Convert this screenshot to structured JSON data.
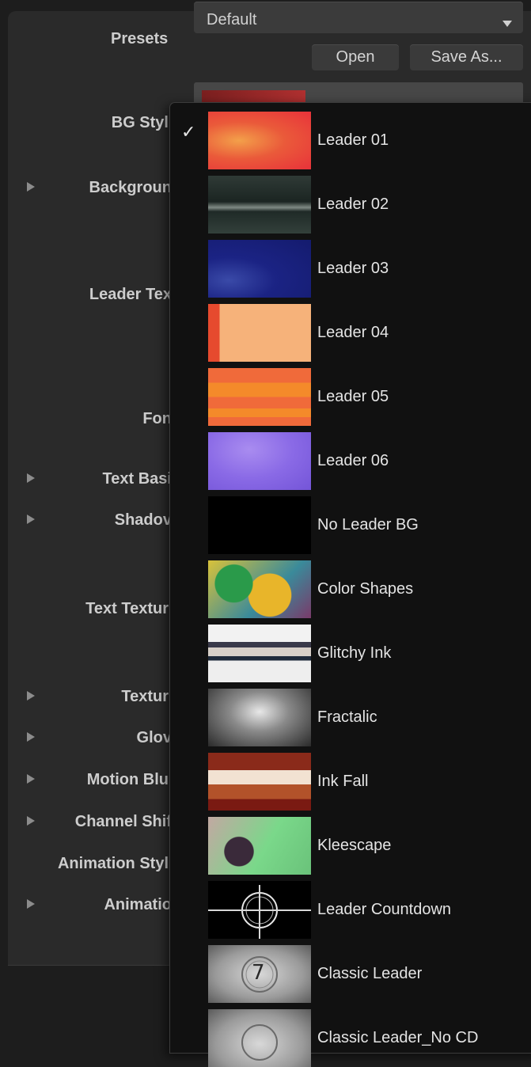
{
  "presets": {
    "label": "Presets",
    "selected": "Default",
    "open_label": "Open",
    "save_as_label": "Save As..."
  },
  "rows": [
    {
      "label": "BG Styl",
      "disclosure": false
    },
    {
      "label": "Backgroun",
      "disclosure": true
    },
    {
      "label": "Leader Tex",
      "disclosure": false
    },
    {
      "label": "Fon",
      "disclosure": false
    },
    {
      "label": "Text Basi",
      "disclosure": true
    },
    {
      "label": "Shadov",
      "disclosure": true
    },
    {
      "label": "Text Textur",
      "disclosure": false
    },
    {
      "label": "Textur",
      "disclosure": true
    },
    {
      "label": "Glov",
      "disclosure": true
    },
    {
      "label": "Motion Blu",
      "disclosure": true
    },
    {
      "label": "Channel Shif",
      "disclosure": true
    },
    {
      "label": "Animation Styl",
      "disclosure": false
    },
    {
      "label": "Animatio",
      "disclosure": true
    }
  ],
  "menu": {
    "checkmark": "✓",
    "items": [
      {
        "label": "Leader 01",
        "checked": true
      },
      {
        "label": "Leader 02",
        "checked": false
      },
      {
        "label": "Leader 03",
        "checked": false
      },
      {
        "label": "Leader 04",
        "checked": false
      },
      {
        "label": "Leader 05",
        "checked": false
      },
      {
        "label": "Leader 06",
        "checked": false
      },
      {
        "label": "No Leader BG",
        "checked": false
      },
      {
        "label": "Color Shapes",
        "checked": false
      },
      {
        "label": "Glitchy Ink",
        "checked": false
      },
      {
        "label": "Fractalic",
        "checked": false
      },
      {
        "label": "Ink Fall",
        "checked": false
      },
      {
        "label": "Kleescape",
        "checked": false
      },
      {
        "label": "Leader Countdown",
        "checked": false
      },
      {
        "label": "Classic Leader",
        "checked": false
      },
      {
        "label": "Classic Leader_No CD",
        "checked": false
      }
    ],
    "classic_leader_digit": "7"
  },
  "colors": {
    "menu_bg": "#111111",
    "panel_bg": "#2a2a2a",
    "text": "#e4e4e4"
  }
}
